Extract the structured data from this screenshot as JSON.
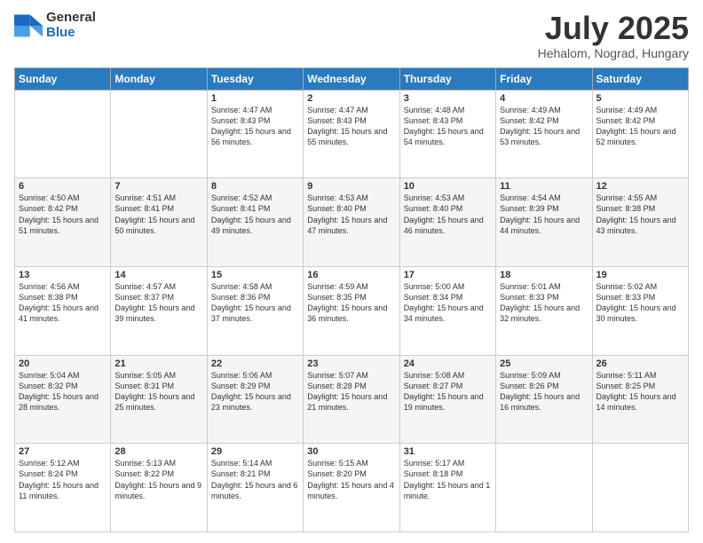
{
  "logo": {
    "general": "General",
    "blue": "Blue"
  },
  "title": {
    "month": "July 2025",
    "location": "Hehalom, Nograd, Hungary"
  },
  "headers": [
    "Sunday",
    "Monday",
    "Tuesday",
    "Wednesday",
    "Thursday",
    "Friday",
    "Saturday"
  ],
  "weeks": [
    [
      {
        "day": "",
        "info": ""
      },
      {
        "day": "",
        "info": ""
      },
      {
        "day": "1",
        "info": "Sunrise: 4:47 AM\nSunset: 8:43 PM\nDaylight: 15 hours and 56 minutes."
      },
      {
        "day": "2",
        "info": "Sunrise: 4:47 AM\nSunset: 8:43 PM\nDaylight: 15 hours and 55 minutes."
      },
      {
        "day": "3",
        "info": "Sunrise: 4:48 AM\nSunset: 8:43 PM\nDaylight: 15 hours and 54 minutes."
      },
      {
        "day": "4",
        "info": "Sunrise: 4:49 AM\nSunset: 8:42 PM\nDaylight: 15 hours and 53 minutes."
      },
      {
        "day": "5",
        "info": "Sunrise: 4:49 AM\nSunset: 8:42 PM\nDaylight: 15 hours and 52 minutes."
      }
    ],
    [
      {
        "day": "6",
        "info": "Sunrise: 4:50 AM\nSunset: 8:42 PM\nDaylight: 15 hours and 51 minutes."
      },
      {
        "day": "7",
        "info": "Sunrise: 4:51 AM\nSunset: 8:41 PM\nDaylight: 15 hours and 50 minutes."
      },
      {
        "day": "8",
        "info": "Sunrise: 4:52 AM\nSunset: 8:41 PM\nDaylight: 15 hours and 49 minutes."
      },
      {
        "day": "9",
        "info": "Sunrise: 4:53 AM\nSunset: 8:40 PM\nDaylight: 15 hours and 47 minutes."
      },
      {
        "day": "10",
        "info": "Sunrise: 4:53 AM\nSunset: 8:40 PM\nDaylight: 15 hours and 46 minutes."
      },
      {
        "day": "11",
        "info": "Sunrise: 4:54 AM\nSunset: 8:39 PM\nDaylight: 15 hours and 44 minutes."
      },
      {
        "day": "12",
        "info": "Sunrise: 4:55 AM\nSunset: 8:38 PM\nDaylight: 15 hours and 43 minutes."
      }
    ],
    [
      {
        "day": "13",
        "info": "Sunrise: 4:56 AM\nSunset: 8:38 PM\nDaylight: 15 hours and 41 minutes."
      },
      {
        "day": "14",
        "info": "Sunrise: 4:57 AM\nSunset: 8:37 PM\nDaylight: 15 hours and 39 minutes."
      },
      {
        "day": "15",
        "info": "Sunrise: 4:58 AM\nSunset: 8:36 PM\nDaylight: 15 hours and 37 minutes."
      },
      {
        "day": "16",
        "info": "Sunrise: 4:59 AM\nSunset: 8:35 PM\nDaylight: 15 hours and 36 minutes."
      },
      {
        "day": "17",
        "info": "Sunrise: 5:00 AM\nSunset: 8:34 PM\nDaylight: 15 hours and 34 minutes."
      },
      {
        "day": "18",
        "info": "Sunrise: 5:01 AM\nSunset: 8:33 PM\nDaylight: 15 hours and 32 minutes."
      },
      {
        "day": "19",
        "info": "Sunrise: 5:02 AM\nSunset: 8:33 PM\nDaylight: 15 hours and 30 minutes."
      }
    ],
    [
      {
        "day": "20",
        "info": "Sunrise: 5:04 AM\nSunset: 8:32 PM\nDaylight: 15 hours and 28 minutes."
      },
      {
        "day": "21",
        "info": "Sunrise: 5:05 AM\nSunset: 8:31 PM\nDaylight: 15 hours and 25 minutes."
      },
      {
        "day": "22",
        "info": "Sunrise: 5:06 AM\nSunset: 8:29 PM\nDaylight: 15 hours and 23 minutes."
      },
      {
        "day": "23",
        "info": "Sunrise: 5:07 AM\nSunset: 8:28 PM\nDaylight: 15 hours and 21 minutes."
      },
      {
        "day": "24",
        "info": "Sunrise: 5:08 AM\nSunset: 8:27 PM\nDaylight: 15 hours and 19 minutes."
      },
      {
        "day": "25",
        "info": "Sunrise: 5:09 AM\nSunset: 8:26 PM\nDaylight: 15 hours and 16 minutes."
      },
      {
        "day": "26",
        "info": "Sunrise: 5:11 AM\nSunset: 8:25 PM\nDaylight: 15 hours and 14 minutes."
      }
    ],
    [
      {
        "day": "27",
        "info": "Sunrise: 5:12 AM\nSunset: 8:24 PM\nDaylight: 15 hours and 11 minutes."
      },
      {
        "day": "28",
        "info": "Sunrise: 5:13 AM\nSunset: 8:22 PM\nDaylight: 15 hours and 9 minutes."
      },
      {
        "day": "29",
        "info": "Sunrise: 5:14 AM\nSunset: 8:21 PM\nDaylight: 15 hours and 6 minutes."
      },
      {
        "day": "30",
        "info": "Sunrise: 5:15 AM\nSunset: 8:20 PM\nDaylight: 15 hours and 4 minutes."
      },
      {
        "day": "31",
        "info": "Sunrise: 5:17 AM\nSunset: 8:18 PM\nDaylight: 15 hours and 1 minute."
      },
      {
        "day": "",
        "info": ""
      },
      {
        "day": "",
        "info": ""
      }
    ]
  ]
}
